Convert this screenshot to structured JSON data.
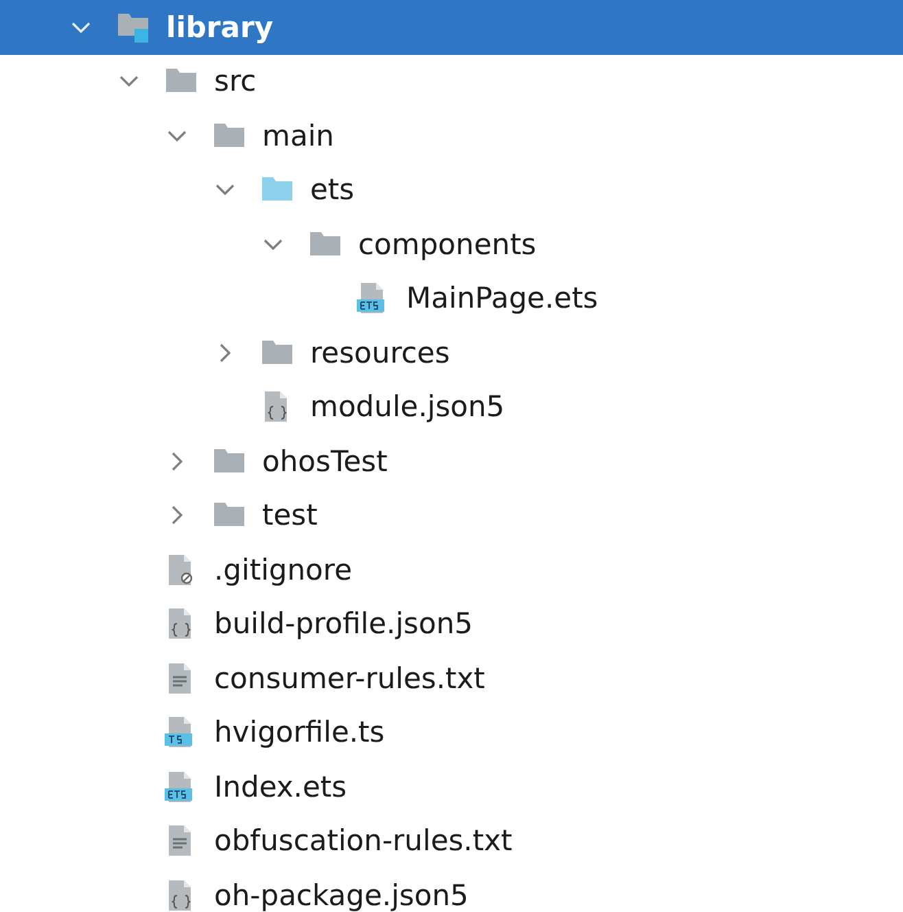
{
  "tree": [
    {
      "label": "library",
      "kind": "module",
      "selected": true,
      "expanded": true,
      "children": [
        {
          "label": "src",
          "kind": "folder",
          "selected": false,
          "expanded": true,
          "children": [
            {
              "label": "main",
              "kind": "folder",
              "selected": false,
              "expanded": true,
              "children": [
                {
                  "label": "ets",
                  "kind": "source-folder",
                  "selected": false,
                  "expanded": true,
                  "children": [
                    {
                      "label": "components",
                      "kind": "folder",
                      "selected": false,
                      "expanded": true,
                      "children": [
                        {
                          "label": "MainPage.ets",
                          "kind": "ets",
                          "selected": false
                        }
                      ]
                    }
                  ]
                },
                {
                  "label": "resources",
                  "kind": "folder",
                  "selected": false,
                  "expanded": false
                },
                {
                  "label": "module.json5",
                  "kind": "json5",
                  "selected": false
                }
              ]
            },
            {
              "label": "ohosTest",
              "kind": "folder",
              "selected": false,
              "expanded": false
            },
            {
              "label": "test",
              "kind": "folder",
              "selected": false,
              "expanded": false
            }
          ]
        },
        {
          "label": ".gitignore",
          "kind": "gitignore",
          "selected": false
        },
        {
          "label": "build-profile.json5",
          "kind": "json5",
          "selected": false
        },
        {
          "label": "consumer-rules.txt",
          "kind": "text",
          "selected": false
        },
        {
          "label": "hvigorfile.ts",
          "kind": "ts",
          "selected": false
        },
        {
          "label": "Index.ets",
          "kind": "ets",
          "selected": false
        },
        {
          "label": "obfuscation-rules.txt",
          "kind": "text",
          "selected": false
        },
        {
          "label": "oh-package.json5",
          "kind": "json5",
          "selected": false
        }
      ]
    }
  ]
}
